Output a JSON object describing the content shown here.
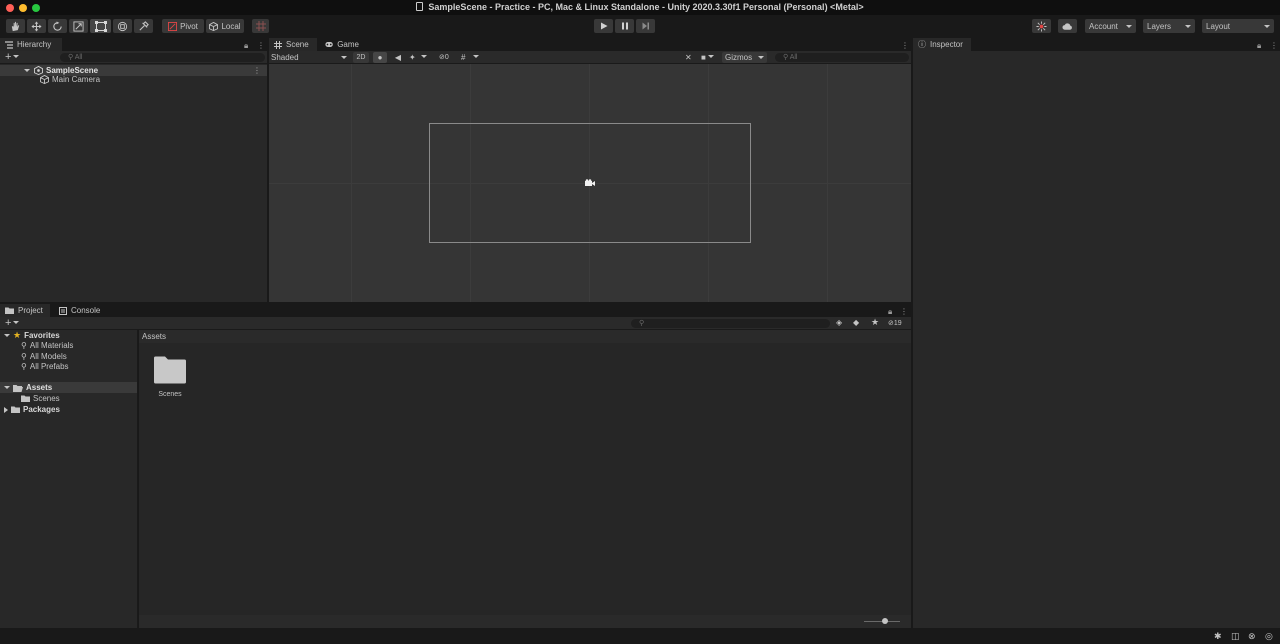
{
  "window": {
    "title": "SampleScene - Practice - PC, Mac & Linux Standalone - Unity 2020.3.30f1 Personal (Personal) <Metal>"
  },
  "toolbar": {
    "pivot_label": "Pivot",
    "local_label": "Local",
    "account_label": "Account",
    "layers_label": "Layers",
    "layout_label": "Layout",
    "tools": [
      "hand-tool",
      "move-tool",
      "rotate-tool",
      "scale-tool",
      "rect-tool",
      "transform-tool",
      "custom-tool"
    ],
    "selected_tool": "rect-tool"
  },
  "hierarchy": {
    "tab_label": "Hierarchy",
    "search_placeholder": "All",
    "scene_name": "SampleScene",
    "items": [
      "Main Camera"
    ]
  },
  "scene": {
    "tabs": [
      "Scene",
      "Game"
    ],
    "shading_mode": "Shaded",
    "mode_2d": "2D",
    "hidden_count": "0",
    "gizmos_label": "Gizmos",
    "search_placeholder": "All"
  },
  "inspector": {
    "tab_label": "Inspector"
  },
  "project": {
    "tabs": [
      "Project",
      "Console"
    ],
    "hidden_count": "19",
    "favorites_label": "Favorites",
    "favorites": [
      "All Materials",
      "All Models",
      "All Prefabs"
    ],
    "assets_label": "Assets",
    "assets_children": [
      "Scenes"
    ],
    "packages_label": "Packages",
    "breadcrumb": "Assets",
    "files": [
      {
        "name": "Scenes",
        "type": "folder"
      }
    ]
  },
  "colors": {
    "background": "#191919",
    "panel": "#282828",
    "scene": "#353535",
    "selected_row": "#3a3a3a",
    "favorite_star": "#e6b422"
  }
}
